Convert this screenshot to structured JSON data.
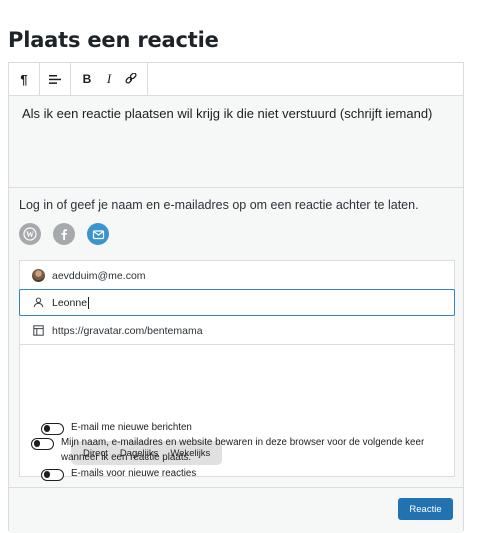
{
  "page": {
    "title": "Plaats een reactie"
  },
  "toolbar": {
    "paragraph_icon": "¶",
    "bold_label": "B",
    "italic_label": "I"
  },
  "editor": {
    "text": "Als ik een reactie plaatsen wil krijg ik die niet verstuurd (schrijft iemand)"
  },
  "login": {
    "prompt": "Log in of geef je naam en e-mailadres op om een reactie achter te laten.",
    "services": [
      "wordpress-icon",
      "facebook-icon",
      "email-icon"
    ]
  },
  "form": {
    "email": "aevdduim@me.com",
    "name": "Leonne",
    "website": "https://gravatar.com/bentemama"
  },
  "subscriptions": {
    "posts_label": "E-mail me nieuwe berichten",
    "frequency_options": [
      "Direct",
      "Dagelijks",
      "Wekelijks"
    ],
    "comments_label": "E-mails voor nieuwe reacties",
    "save_label": "Mijn naam, e-mailadres en website bewaren in deze browser voor de volgende keer wanneer ik een reactie plaats."
  },
  "actions": {
    "submit_label": "Reactie"
  },
  "colors": {
    "accent": "#2271b1",
    "focus": "#3582c4",
    "mail": "#3a95cf"
  }
}
